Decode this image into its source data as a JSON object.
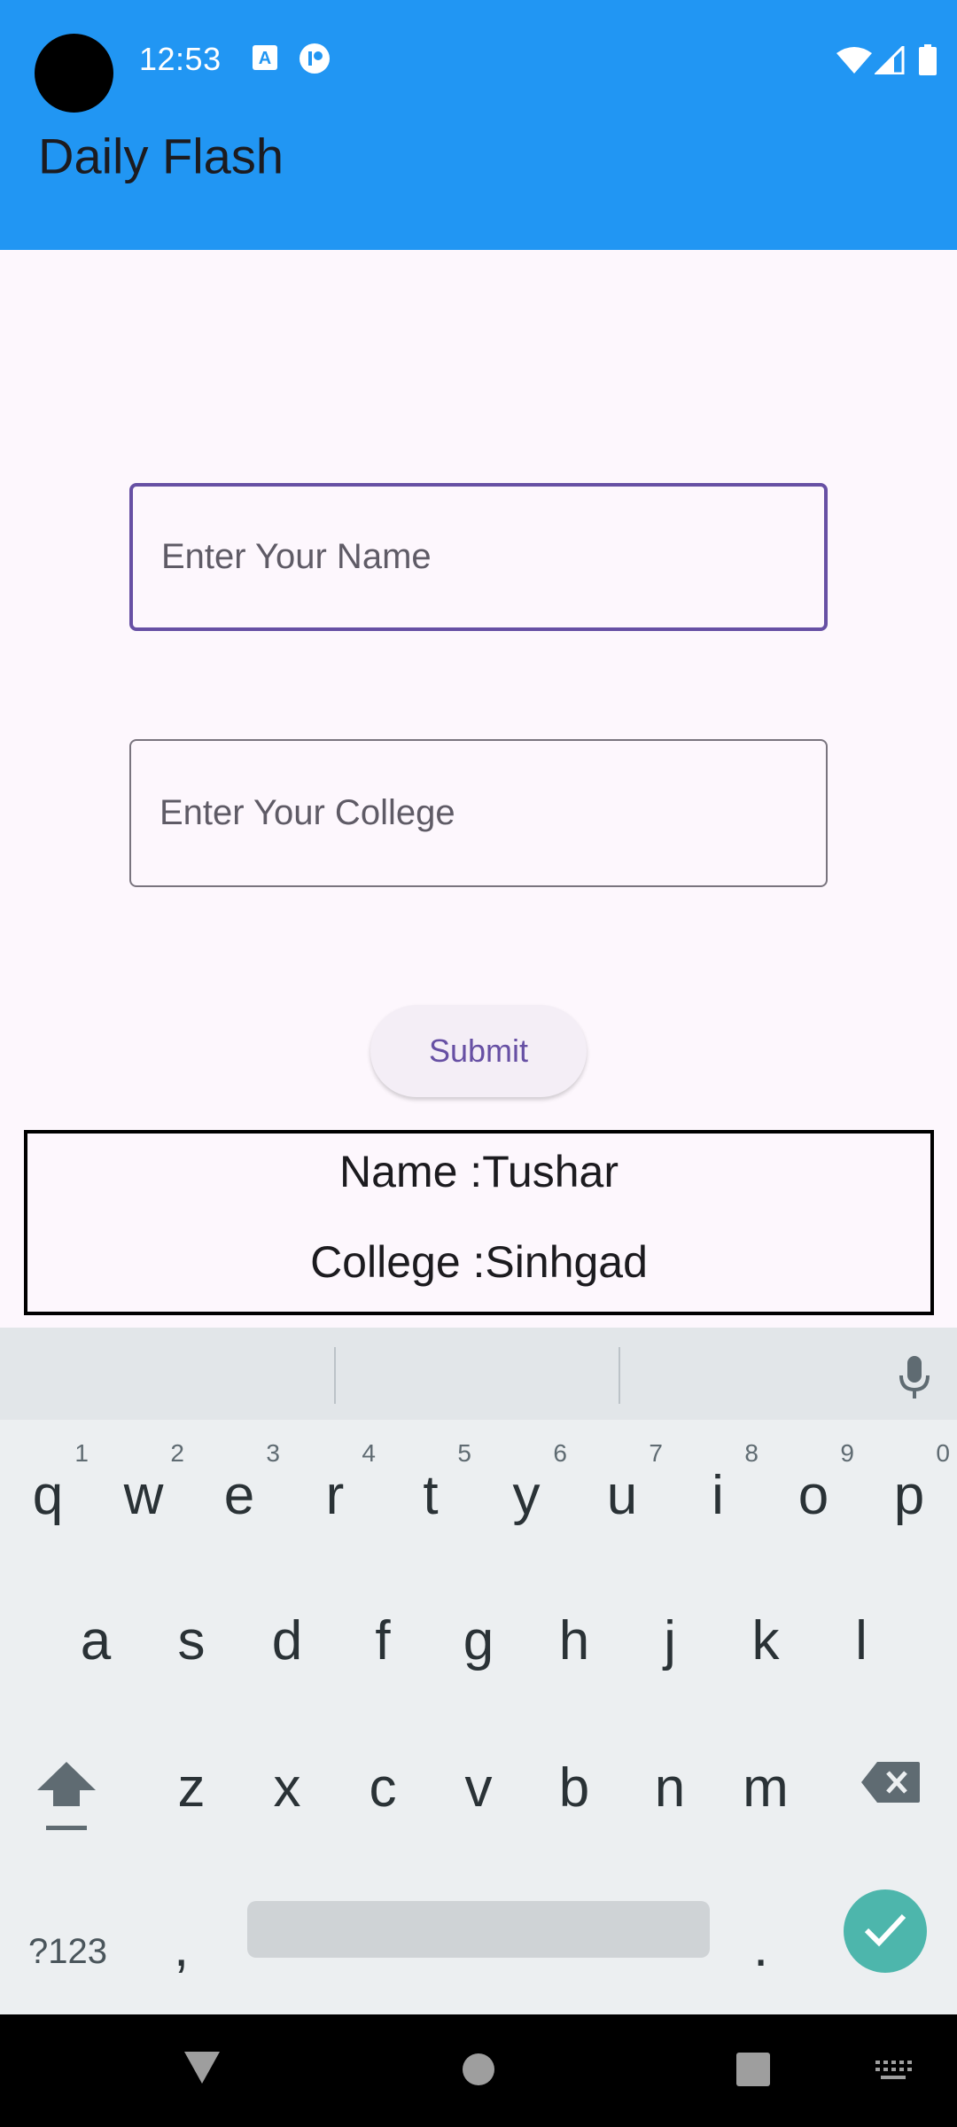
{
  "status_bar": {
    "time": "12:53",
    "icons": [
      "text-a-icon",
      "notification-icon",
      "wifi-icon",
      "signal-icon",
      "battery-icon"
    ]
  },
  "app_bar": {
    "title": "Daily Flash",
    "color": "#2196f3"
  },
  "form": {
    "name_placeholder": "Enter Your Name",
    "name_value": "",
    "college_placeholder": "Enter Your College",
    "college_value": "",
    "submit_label": "Submit",
    "accent_color": "#6750a4"
  },
  "result": {
    "name_label": "Name :",
    "name_value": "Tushar",
    "college_label": "College :",
    "college_value": "Sinhgad"
  },
  "keyboard": {
    "row1": [
      {
        "ch": "q",
        "hint": "1"
      },
      {
        "ch": "w",
        "hint": "2"
      },
      {
        "ch": "e",
        "hint": "3"
      },
      {
        "ch": "r",
        "hint": "4"
      },
      {
        "ch": "t",
        "hint": "5"
      },
      {
        "ch": "y",
        "hint": "6"
      },
      {
        "ch": "u",
        "hint": "7"
      },
      {
        "ch": "i",
        "hint": "8"
      },
      {
        "ch": "o",
        "hint": "9"
      },
      {
        "ch": "p",
        "hint": "0"
      }
    ],
    "row2": [
      "a",
      "s",
      "d",
      "f",
      "g",
      "h",
      "j",
      "k",
      "l"
    ],
    "row3": [
      "z",
      "x",
      "c",
      "v",
      "b",
      "n",
      "m"
    ],
    "symbols_label": "?123",
    "comma": ",",
    "period": ".",
    "enter_color": "#4db6ac"
  },
  "nav_bar": {
    "buttons": [
      "back-icon",
      "home-icon",
      "recents-icon",
      "keyboard-switch-icon"
    ]
  }
}
